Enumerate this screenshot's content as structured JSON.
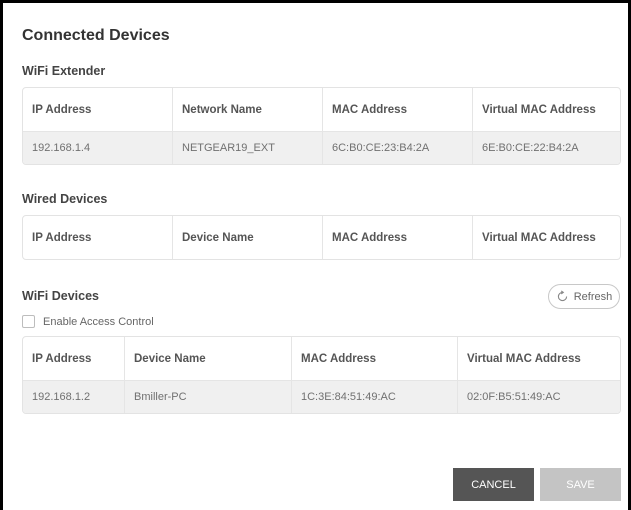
{
  "page": {
    "title": "Connected Devices"
  },
  "wifi_extender": {
    "title": "WiFi Extender",
    "columns": [
      "IP Address",
      "Network Name",
      "MAC Address",
      "Virtual MAC Address"
    ],
    "rows": [
      [
        "192.168.1.4",
        "NETGEAR19_EXT",
        "6C:B0:CE:23:B4:2A",
        "6E:B0:CE:22:B4:2A"
      ]
    ]
  },
  "wired_devices": {
    "title": "Wired Devices",
    "columns": [
      "IP Address",
      "Device Name",
      "MAC Address",
      "Virtual MAC Address"
    ],
    "rows": []
  },
  "wifi_devices": {
    "title": "WiFi Devices",
    "refresh_label": "Refresh",
    "access_control_label": "Enable Access Control",
    "access_control_checked": false,
    "columns": [
      "IP Address",
      "Device Name",
      "MAC Address",
      "Virtual MAC Address"
    ],
    "rows": [
      [
        "192.168.1.2",
        "Bmiller-PC",
        "1C:3E:84:51:49:AC",
        "02:0F:B5:51:49:AC"
      ]
    ]
  },
  "actions": {
    "cancel_label": "CANCEL",
    "save_label": "SAVE"
  },
  "colors": {
    "cancel_bg": "#555555",
    "save_bg": "#c4c4c4",
    "row_bg": "#f0f0f0"
  }
}
